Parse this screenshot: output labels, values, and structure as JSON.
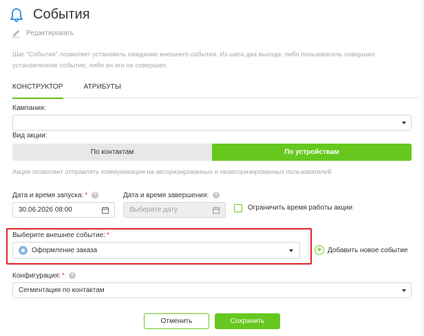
{
  "header": {
    "title": "События",
    "edit_label": "Редактировать"
  },
  "description": "Шаг \"События\" позволяет установить ожидание внешнего события. Из шага два выхода: либо пользователь совершил установленное событие, либо он его не совершил.",
  "tabs": [
    {
      "label": "КОНСТРУКТОР",
      "active": true
    },
    {
      "label": "АТРИБУТЫ",
      "active": false
    }
  ],
  "campaign": {
    "label": "Кампания:",
    "value": ""
  },
  "action_type": {
    "label": "Вид акции:",
    "options": [
      "По контактам",
      "По устройствам"
    ],
    "selected": "По устройствам",
    "hint": "Акция позволяет отправлять коммуникации на авторизированных и неавторизированных пользователей"
  },
  "start": {
    "label": "Дата и время запуска:",
    "required_mark": "*",
    "value": "30.06.2026 08:00"
  },
  "end": {
    "label": "Дата и время завершения:",
    "placeholder": "Выберите дату"
  },
  "limit_time": {
    "label": "Ограничить время работы акции",
    "checked": false
  },
  "external_event": {
    "label": "Выберите внешнее событие:",
    "required_mark": "*",
    "value": "Оформление заказа",
    "add_label": "Добавить новое событие"
  },
  "configuration": {
    "label": "Конфигурация:",
    "required_mark": "*",
    "value": "Сегментация по контактам"
  },
  "buttons": {
    "cancel": "Отменить",
    "save": "Сохранить"
  },
  "colors": {
    "accent": "#66c81e",
    "highlight": "#e0232b",
    "bell": "#1e88e5"
  },
  "icons": [
    "bell-icon",
    "pencil-icon",
    "help-icon",
    "calendar-icon",
    "chevron-down-icon",
    "plus-circle-icon",
    "event-dot-icon"
  ]
}
